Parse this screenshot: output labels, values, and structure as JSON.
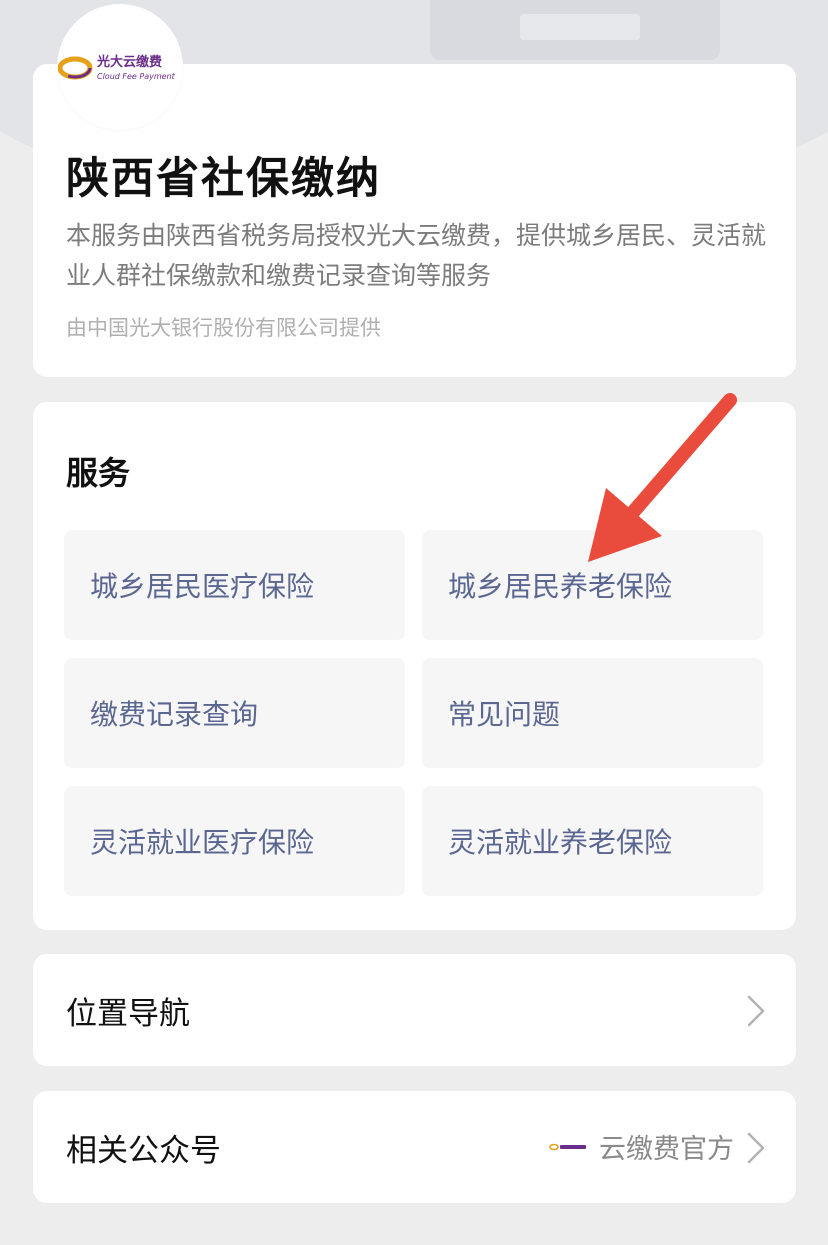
{
  "header": {
    "logo_icon": "cloud-fee-payment-logo",
    "logo_text_cn": "光大云缴费",
    "logo_text_en": "Cloud Fee Payment"
  },
  "intro": {
    "title": "陕西省社保缴纳",
    "description": "本服务由陕西省税务局授权光大云缴费，提供城乡居民、灵活就业人群社保缴款和缴费记录查询等服务",
    "provider": "由中国光大银行股份有限公司提供"
  },
  "services": {
    "title": "服务",
    "items": [
      {
        "label": "城乡居民医疗保险"
      },
      {
        "label": "城乡居民养老保险"
      },
      {
        "label": "缴费记录查询"
      },
      {
        "label": "常见问题"
      },
      {
        "label": "灵活就业医疗保险"
      },
      {
        "label": "灵活就业养老保险"
      }
    ]
  },
  "navigation": {
    "label": "位置导航",
    "icon": "chevron-right-icon"
  },
  "official_account": {
    "label": "相关公众号",
    "account_name": "云缴费官方",
    "icon": "chevron-right-icon"
  },
  "annotation": {
    "arrow_color": "#e94b3c",
    "icon": "red-arrow-icon"
  },
  "colors": {
    "background": "#ededed",
    "card": "#ffffff",
    "service_text": "#5b6790",
    "logo_purple": "#6b2d8a",
    "logo_gold": "#e5a11a"
  }
}
